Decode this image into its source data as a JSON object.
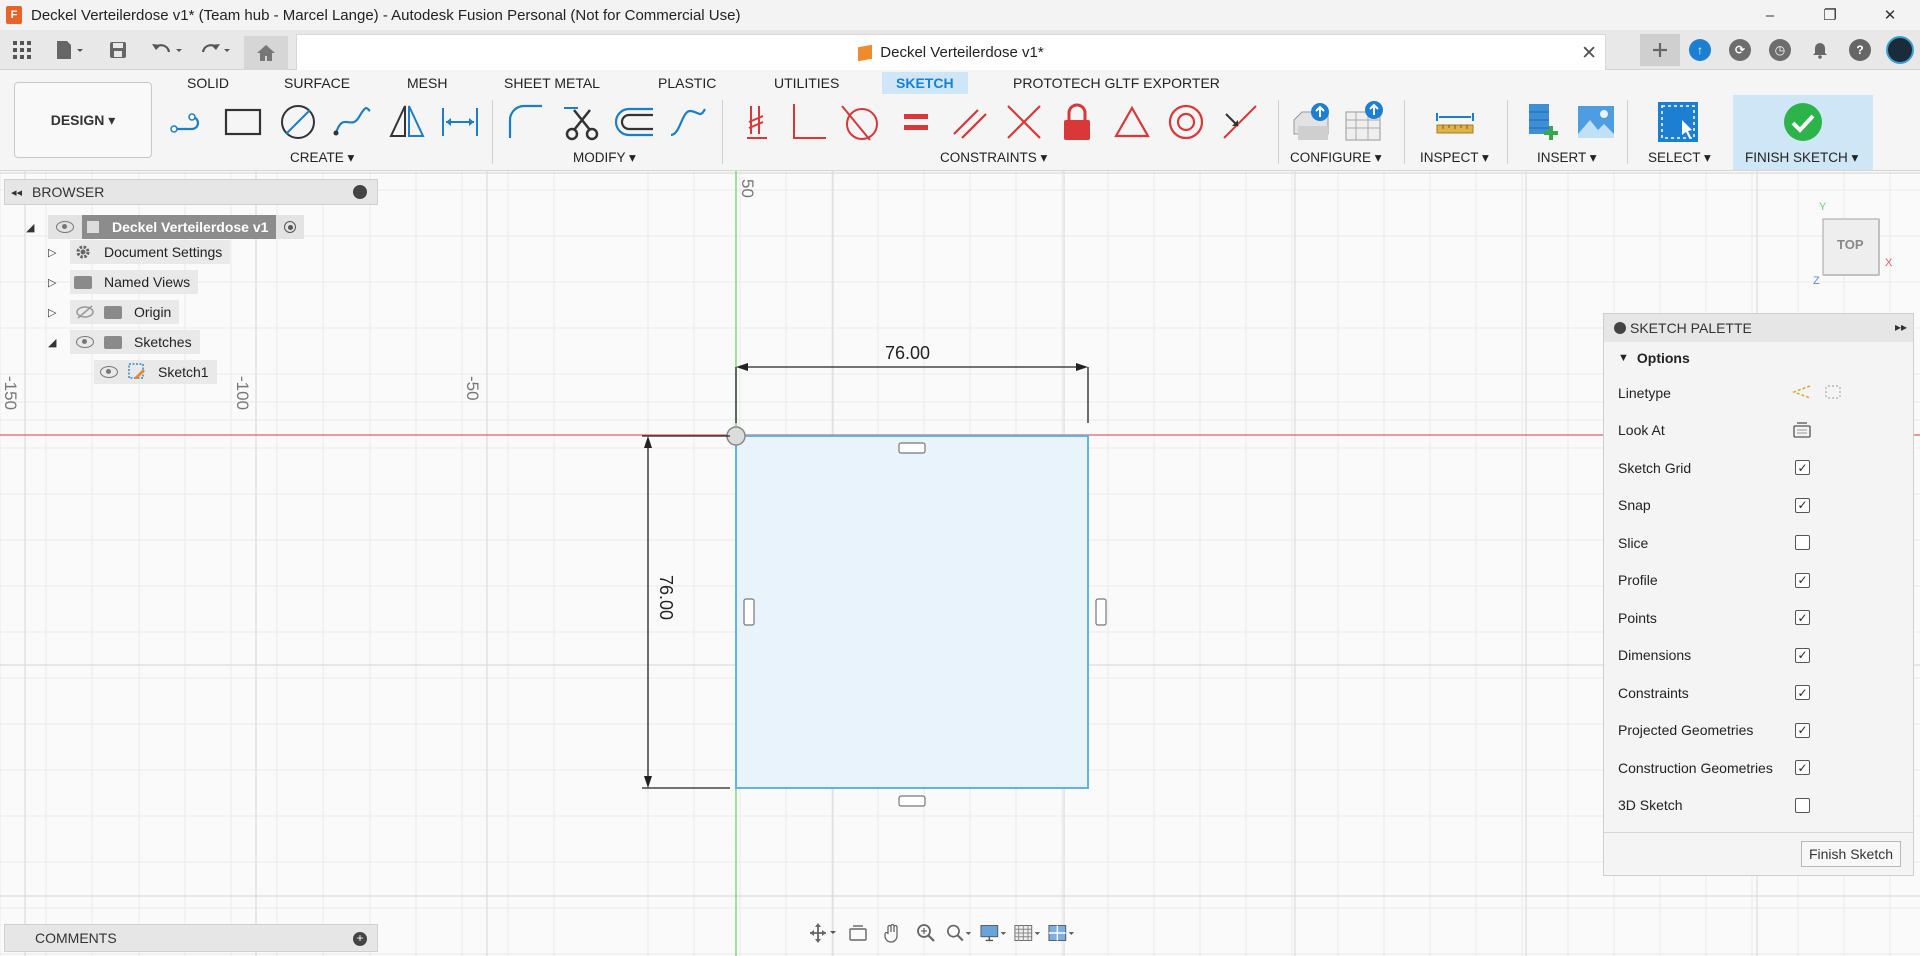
{
  "window": {
    "title": "Deckel Verteilerdose v1* (Team hub - Marcel Lange) - Autodesk Fusion Personal (Not for Commercial Use)",
    "logo_letter": "F",
    "minimize": "–",
    "maximize": "❐",
    "close": "✕"
  },
  "document_tab": {
    "title": "Deckel Verteilerdose v1*",
    "close": "✕"
  },
  "ribbon": {
    "workspace": "DESIGN ▾",
    "tabs": [
      "SOLID",
      "SURFACE",
      "MESH",
      "SHEET METAL",
      "PLASTIC",
      "UTILITIES",
      "SKETCH",
      "PROTOTECH GLTF EXPORTER"
    ],
    "active_tab": "SKETCH",
    "groups": [
      "CREATE ▾",
      "MODIFY ▾",
      "CONSTRAINTS ▾",
      "CONFIGURE ▾",
      "INSPECT ▾",
      "INSERT ▾",
      "SELECT ▾",
      "FINISH SKETCH ▾"
    ]
  },
  "browser": {
    "title": "BROWSER",
    "collapse": "◂◂",
    "root": "Deckel Verteilerdose v1",
    "items": [
      {
        "label": "Document Settings"
      },
      {
        "label": "Named Views"
      },
      {
        "label": "Origin"
      },
      {
        "label": "Sketches"
      },
      {
        "label": "Sketch1"
      }
    ]
  },
  "comments": {
    "title": "COMMENTS",
    "plus": "+"
  },
  "axis_labels": {
    "x": [
      "-150",
      "-100",
      "-50"
    ],
    "y": [
      "50"
    ]
  },
  "dimensions": {
    "width": "76.00",
    "height": "76.00"
  },
  "viewcube": {
    "face": "TOP",
    "x": "X",
    "y": "Y",
    "z": "Z"
  },
  "sketch_palette": {
    "title": "SKETCH PALETTE",
    "expand": "▸▸",
    "section": "Options",
    "options": [
      {
        "label": "Linetype",
        "kind": "icon"
      },
      {
        "label": "Look At",
        "kind": "icon"
      },
      {
        "label": "Sketch Grid",
        "checked": true
      },
      {
        "label": "Snap",
        "checked": true
      },
      {
        "label": "Slice",
        "checked": false
      },
      {
        "label": "Profile",
        "checked": true
      },
      {
        "label": "Points",
        "checked": true
      },
      {
        "label": "Dimensions",
        "checked": true
      },
      {
        "label": "Constraints",
        "checked": true
      },
      {
        "label": "Projected Geometries",
        "checked": true
      },
      {
        "label": "Construction Geometries",
        "checked": true
      },
      {
        "label": "3D Sketch",
        "checked": false
      }
    ],
    "finish_button": "Finish Sketch"
  },
  "colors": {
    "accent": "#1782d0",
    "sketch_fill": "#e8f3fb",
    "sketch_line": "#5fb4e6",
    "x_axis": "#e06060",
    "y_axis": "#6fd26f",
    "constraint_red": "#d83838"
  }
}
